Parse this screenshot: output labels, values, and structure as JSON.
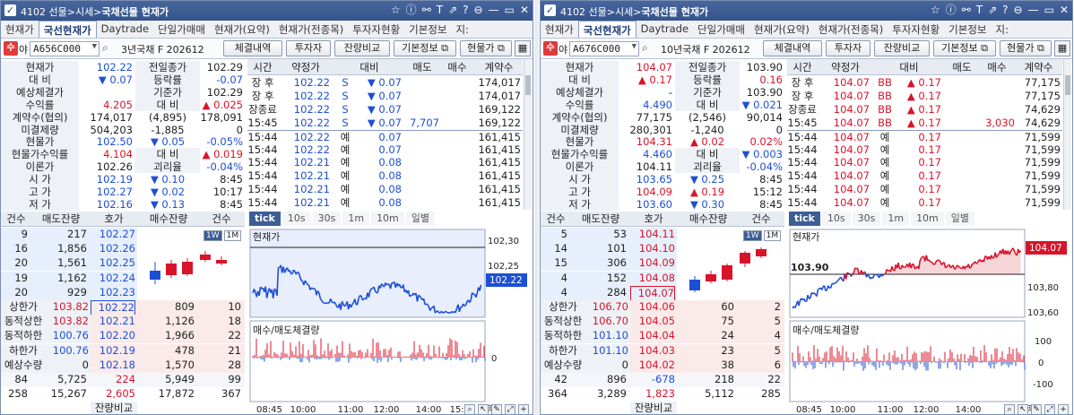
{
  "panels": [
    {
      "title_prefix": "4102 선물>시세>",
      "title_main": "국채선물 현재가",
      "tabs": [
        "현재가",
        "국선현재가",
        "Daytrade",
        "단일가매매",
        "현재가(요약)",
        "현재가(전종목)",
        "투자자현황",
        "기본정보",
        "지:"
      ],
      "active_tab": 1,
      "code": "A656C000",
      "code_name": "3년국채 F 202612",
      "buttons": {
        "b1": "체결내역",
        "b2": "투자자",
        "b3": "잔량비교",
        "b4": "기본정보",
        "b5": "현물가"
      },
      "quote": [
        {
          "l1": "현재가",
          "v1": "102.22",
          "c1": "blue",
          "l2": "전일종가",
          "v2": "102.29",
          "c2": "blk"
        },
        {
          "l1": "대    비",
          "v1": "▼ 0.07",
          "c1": "blue",
          "l2": "등락률",
          "v2": "-0.07",
          "c2": "blue"
        },
        {
          "l1": "예상체결가",
          "v1": "",
          "c1": "blk",
          "l2": "기준가",
          "v2": "102.29",
          "c2": "blk"
        },
        {
          "l1": "수익률",
          "v1": "4.205",
          "c1": "red",
          "l2": "대    비",
          "v2": "▲ 0.025",
          "c2": "red"
        },
        {
          "l1": "계약수(협의)",
          "v1": "174,017",
          "c1": "blk",
          "l2": "(4,895)",
          "v2": "178,091",
          "c2": "blk"
        },
        {
          "l1": "미결제량",
          "v1": "504,203",
          "c1": "blk",
          "l2": "-1,885",
          "v2": "0",
          "c2": "blk"
        },
        {
          "l1": "현물가",
          "v1": "102.50",
          "c1": "blue",
          "l2": "▼ 0.05",
          "v2": "-0.05%",
          "c2": "blue"
        },
        {
          "l1": "현물가수익률",
          "v1": "4.104",
          "c1": "red",
          "l2": "대    비",
          "v2": "▲ 0.019",
          "c2": "red"
        },
        {
          "l1": "이론가",
          "v1": "102.26",
          "c1": "blk",
          "l2": "괴리율",
          "v2": "-0.04%",
          "c2": "blue"
        },
        {
          "l1": "시    가",
          "v1": "102.19",
          "c1": "blue",
          "l2": "▼ 0.10",
          "v2": "8:45",
          "c2": "blk"
        },
        {
          "l1": "고    가",
          "v1": "102.27",
          "c1": "blue",
          "l2": "▼ 0.02",
          "v2": "10:17",
          "c2": "blk"
        },
        {
          "l1": "저    가",
          "v1": "102.16",
          "c1": "blue",
          "l2": "▼ 0.13",
          "v2": "8:45",
          "c2": "blk"
        }
      ],
      "trade_headers": [
        "시간",
        "약정가",
        "대비",
        "매도",
        "매수",
        "계약수"
      ],
      "trades": [
        {
          "t": "장 후",
          "p": "102.22",
          "f": "S",
          "d": "▼ 0.07",
          "s": "",
          "b": "",
          "q": "174,017"
        },
        {
          "t": "장 후",
          "p": "102.22",
          "f": "S",
          "d": "▼ 0.07",
          "s": "",
          "b": "",
          "q": "174,017"
        },
        {
          "t": "장종료",
          "p": "102.22",
          "f": "S",
          "d": "▼ 0.07",
          "s": "",
          "b": "",
          "q": "169,122"
        },
        {
          "t": "15:45",
          "p": "102.22",
          "f": "S",
          "d": "▼ 0.07",
          "s": "7,707",
          "b": "",
          "q": "169,122"
        },
        {
          "t": "15:44",
          "p": "102.22",
          "f": "예",
          "d": "0.07",
          "s": "",
          "b": "",
          "q": "161,415"
        },
        {
          "t": "15:44",
          "p": "102.22",
          "f": "예",
          "d": "0.07",
          "s": "",
          "b": "",
          "q": "161,415"
        },
        {
          "t": "15:44",
          "p": "102.21",
          "f": "예",
          "d": "0.08",
          "s": "",
          "b": "",
          "q": "161,415"
        },
        {
          "t": "15:44",
          "p": "102.21",
          "f": "예",
          "d": "0.08",
          "s": "",
          "b": "",
          "q": "161,415"
        },
        {
          "t": "15:44",
          "p": "102.21",
          "f": "예",
          "d": "0.08",
          "s": "",
          "b": "",
          "q": "161,415"
        },
        {
          "t": "15:44",
          "p": "102.21",
          "f": "예",
          "d": "0.08",
          "s": "",
          "b": "",
          "q": "161,415"
        }
      ],
      "ob_headers": [
        "건수",
        "매도잔량",
        "호가",
        "매수잔량",
        "건수"
      ],
      "asks": [
        {
          "c": "9",
          "q": "217",
          "p": "102.27"
        },
        {
          "c": "16",
          "q": "1,856",
          "p": "102.26"
        },
        {
          "c": "20",
          "q": "1,561",
          "p": "102.25"
        },
        {
          "c": "19",
          "q": "1,162",
          "p": "102.24"
        },
        {
          "c": "20",
          "q": "929",
          "p": "102.23"
        }
      ],
      "bids": [
        {
          "p": "102.22",
          "q": "809",
          "c": "10"
        },
        {
          "p": "102.21",
          "q": "1,126",
          "c": "18"
        },
        {
          "p": "102.20",
          "q": "1,966",
          "c": "22"
        },
        {
          "p": "102.19",
          "q": "478",
          "c": "21"
        },
        {
          "p": "102.18",
          "q": "1,570",
          "c": "28"
        }
      ],
      "limits": [
        {
          "l": "상한가",
          "v": "103.82"
        },
        {
          "l": "동적상한",
          "v": "103.82"
        },
        {
          "l": "동적하한",
          "v": "100.76"
        },
        {
          "l": "하한가",
          "v": "100.76"
        },
        {
          "l": "예상수량",
          "v": "0"
        }
      ],
      "ob_total1": {
        "a": "84",
        "b": "5,725",
        "c": "224",
        "d": "5,949",
        "e": "99"
      },
      "ob_total2": {
        "a": "258",
        "b": "15,267",
        "c": "2,605",
        "d": "17,872",
        "e": "367"
      },
      "ob_footer": "잔량비교",
      "week_tabs": [
        "1W",
        "1M"
      ],
      "chart_tabs": [
        "tick",
        "10s",
        "30s",
        "1m",
        "10m",
        "일별"
      ],
      "chart_label_price": "현재가",
      "chart_label_vol": "매수/매도체결량",
      "price_axis": [
        "102,30",
        "102,25",
        "102,22"
      ],
      "vol_axis": [
        "0"
      ],
      "time_axis": [
        "08:45",
        "10:00",
        "11:00",
        "12:00",
        "14:00",
        "15:00",
        "장후"
      ],
      "last_price_tag": "102.22"
    },
    {
      "title_prefix": "4102 선물>시세>",
      "title_main": "국채선물 현재가",
      "tabs": [
        "현재가",
        "국선현재가",
        "Daytrade",
        "단일가매매",
        "현재가(요약)",
        "현재가(전종목)",
        "투자자현황",
        "기본정보",
        "지:"
      ],
      "active_tab": 1,
      "code": "A676C000",
      "code_name": "10년국채 F 202612",
      "buttons": {
        "b1": "체결내역",
        "b2": "투자자",
        "b3": "잔량비교",
        "b4": "기본정보",
        "b5": "현물가"
      },
      "quote": [
        {
          "l1": "현재가",
          "v1": "104.07",
          "c1": "red",
          "l2": "전일종가",
          "v2": "103.90",
          "c2": "blk"
        },
        {
          "l1": "대    비",
          "v1": "▲ 0.17",
          "c1": "red",
          "l2": "등락률",
          "v2": "0.16",
          "c2": "red"
        },
        {
          "l1": "예상체결가",
          "v1": "-",
          "c1": "blk",
          "l2": "기준가",
          "v2": "103.90",
          "c2": "blk"
        },
        {
          "l1": "수익률",
          "v1": "4.490",
          "c1": "blue",
          "l2": "대    비",
          "v2": "▼ 0.021",
          "c2": "blue"
        },
        {
          "l1": "계약수(협의)",
          "v1": "77,175",
          "c1": "blk",
          "l2": "(2,546)",
          "v2": "90,014",
          "c2": "blk"
        },
        {
          "l1": "미결제량",
          "v1": "280,301",
          "c1": "blk",
          "l2": "-1,240",
          "v2": "0",
          "c2": "blk"
        },
        {
          "l1": "현물가",
          "v1": "104.31",
          "c1": "red",
          "l2": "▲ 0.02",
          "v2": "0.02%",
          "c2": "red"
        },
        {
          "l1": "현물가수익률",
          "v1": "4.460",
          "c1": "blue",
          "l2": "대    비",
          "v2": "▼ 0.003",
          "c2": "blue"
        },
        {
          "l1": "이론가",
          "v1": "104.11",
          "c1": "blk",
          "l2": "괴리율",
          "v2": "-0.04%",
          "c2": "blue"
        },
        {
          "l1": "시    가",
          "v1": "103.65",
          "c1": "blue",
          "l2": "▼ 0.25",
          "v2": "8:45",
          "c2": "blk"
        },
        {
          "l1": "고    가",
          "v1": "104.09",
          "c1": "red",
          "l2": "▲ 0.19",
          "v2": "15:12",
          "c2": "blk"
        },
        {
          "l1": "저    가",
          "v1": "103.60",
          "c1": "blue",
          "l2": "▼ 0.30",
          "v2": "8:45",
          "c2": "blk"
        }
      ],
      "trade_headers": [
        "시간",
        "약정가",
        "대비",
        "매도",
        "매수",
        "계약수"
      ],
      "trades": [
        {
          "t": "장 후",
          "p": "104.07",
          "f": "BB",
          "d": "▲ 0.17",
          "s": "",
          "b": "",
          "q": "77,175"
        },
        {
          "t": "장 후",
          "p": "104.07",
          "f": "BB",
          "d": "▲ 0.17",
          "s": "",
          "b": "",
          "q": "77,175"
        },
        {
          "t": "장종료",
          "p": "104.07",
          "f": "BB",
          "d": "▲ 0.17",
          "s": "",
          "b": "",
          "q": "74,629"
        },
        {
          "t": "15:45",
          "p": "104.07",
          "f": "BB",
          "d": "▲ 0.17",
          "s": "",
          "b": "3,030",
          "q": "74,629"
        },
        {
          "t": "15:44",
          "p": "104.07",
          "f": "예",
          "d": "0.17",
          "s": "",
          "b": "",
          "q": "71,599"
        },
        {
          "t": "15:44",
          "p": "104.07",
          "f": "예",
          "d": "0.17",
          "s": "",
          "b": "",
          "q": "71,599"
        },
        {
          "t": "15:44",
          "p": "104.07",
          "f": "예",
          "d": "0.17",
          "s": "",
          "b": "",
          "q": "71,599"
        },
        {
          "t": "15:44",
          "p": "104.07",
          "f": "예",
          "d": "0.17",
          "s": "",
          "b": "",
          "q": "71,599"
        },
        {
          "t": "15:44",
          "p": "104.07",
          "f": "예",
          "d": "0.17",
          "s": "",
          "b": "",
          "q": "71,599"
        },
        {
          "t": "15:44",
          "p": "104.07",
          "f": "예",
          "d": "0.17",
          "s": "",
          "b": "",
          "q": "71,599"
        }
      ],
      "ob_headers": [
        "건수",
        "매도잔량",
        "호가",
        "매수잔량",
        "건수"
      ],
      "asks": [
        {
          "c": "5",
          "q": "53",
          "p": "104.11"
        },
        {
          "c": "14",
          "q": "101",
          "p": "104.10"
        },
        {
          "c": "15",
          "q": "306",
          "p": "104.09"
        },
        {
          "c": "4",
          "q": "152",
          "p": "104.08"
        },
        {
          "c": "4",
          "q": "284",
          "p": "104.07"
        }
      ],
      "bids": [
        {
          "p": "104.06",
          "q": "60",
          "c": "2"
        },
        {
          "p": "104.05",
          "q": "75",
          "c": "5"
        },
        {
          "p": "104.04",
          "q": "24",
          "c": "4"
        },
        {
          "p": "104.03",
          "q": "23",
          "c": "5"
        },
        {
          "p": "104.02",
          "q": "38",
          "c": "6"
        }
      ],
      "limits": [
        {
          "l": "상한가",
          "v": "106.70"
        },
        {
          "l": "동적상한",
          "v": "106.70"
        },
        {
          "l": "동적하한",
          "v": "101.10"
        },
        {
          "l": "하한가",
          "v": "101.10"
        },
        {
          "l": "예상수량",
          "v": "0"
        }
      ],
      "ob_total1": {
        "a": "42",
        "b": "896",
        "c": "-678",
        "d": "218",
        "e": "22"
      },
      "ob_total2": {
        "a": "364",
        "b": "3,289",
        "c": "1,823",
        "d": "5,112",
        "e": "285"
      },
      "ob_footer": "잔량비교",
      "week_tabs": [
        "1W",
        "1M"
      ],
      "chart_tabs": [
        "tick",
        "10s",
        "30s",
        "1m",
        "10m",
        "일별"
      ],
      "chart_label_price": "현재가",
      "chart_label_vol": "매수/매도체결량",
      "price_axis": [
        "103,80",
        "103,60"
      ],
      "ref_price_label": "103.90",
      "vol_axis": [
        "100",
        "0",
        "-100"
      ],
      "time_axis": [
        "08:45",
        "10:00",
        "11:00",
        "12:00",
        "14:00",
        "장후"
      ],
      "last_price_tag": "104.07"
    }
  ],
  "colors": {
    "red": "#d8142b",
    "blue": "#1d4fd6",
    "title": "#35548b"
  }
}
